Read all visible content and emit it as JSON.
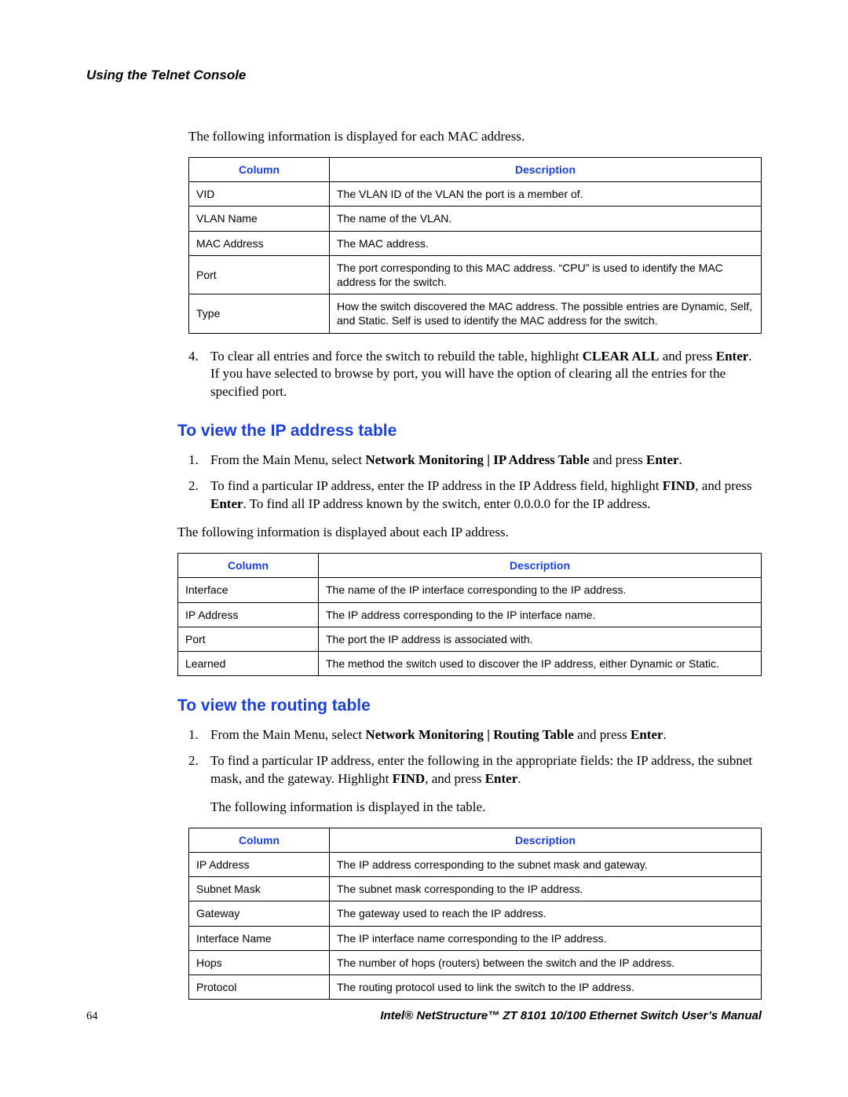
{
  "header": {
    "running_title": "Using the Telnet Console"
  },
  "intro1": "The following information is displayed for each MAC address.",
  "table1": {
    "head_col": "Column",
    "head_desc": "Description",
    "rows": [
      {
        "c": "VID",
        "d": "The VLAN ID of the VLAN the port is a member of."
      },
      {
        "c": "VLAN Name",
        "d": "The name of the VLAN."
      },
      {
        "c": "MAC Address",
        "d": "The MAC address."
      },
      {
        "c": "Port",
        "d": "The port corresponding to this MAC address. “CPU” is used to identify the MAC address for the switch."
      },
      {
        "c": "Type",
        "d": "How the switch discovered the MAC address. The possible entries are Dynamic, Self, and Static. Self is used to identify the MAC address for the switch."
      }
    ]
  },
  "step_a": {
    "num": "4.",
    "t1": "To clear all entries and force the switch to rebuild the table, highlight ",
    "b1": "CLEAR ALL",
    "t2": " and press ",
    "b2": "Enter",
    "t3": ". If you have selected to browse by port, you will have the option of clearing all the entries for the specified port."
  },
  "section2": {
    "title": "To view the IP address table"
  },
  "step_b1": {
    "num": "1.",
    "t1": "From the Main Menu, select ",
    "b1": "Network Monitoring | IP Address Table",
    "t2": " and press ",
    "b2": "Enter",
    "t3": "."
  },
  "step_b2": {
    "num": "2.",
    "t1": "To find a particular IP address, enter the IP address in the IP Address field, highlight ",
    "b1": "FIND",
    "t2": ", and press ",
    "b2": "Enter",
    "t3": ". To find all IP address known by the switch, enter 0.0.0.0 for the IP address."
  },
  "intro2": "The following information is displayed about each IP address.",
  "table2": {
    "head_col": "Column",
    "head_desc": "Description",
    "rows": [
      {
        "c": "Interface",
        "d": "The name of the IP interface corresponding to the IP address."
      },
      {
        "c": "IP Address",
        "d": "The IP address corresponding to the IP interface name."
      },
      {
        "c": "Port",
        "d": "The port the IP address is associated with."
      },
      {
        "c": "Learned",
        "d": "The method the switch used to discover the IP address, either Dynamic or Static."
      }
    ]
  },
  "section3": {
    "title": "To view the routing table"
  },
  "step_c1": {
    "num": "1.",
    "t1": "From the Main Menu, select ",
    "b1": "Network Monitoring | Routing Table",
    "t2": " and press ",
    "b2": "Enter",
    "t3": "."
  },
  "step_c2": {
    "num": "2.",
    "t1": "To find a particular IP address, enter the following in the appropriate fields: the IP address, the subnet mask, and the gateway. Highlight ",
    "b1": "FIND",
    "t2": ", and press ",
    "b2": "Enter",
    "t3": "."
  },
  "intro3": "The following information is displayed in the table.",
  "table3": {
    "head_col": "Column",
    "head_desc": "Description",
    "rows": [
      {
        "c": "IP Address",
        "d": "The IP address corresponding to the subnet mask and gateway."
      },
      {
        "c": "Subnet Mask",
        "d": "The subnet mask corresponding to the IP address."
      },
      {
        "c": "Gateway",
        "d": "The gateway used to reach the IP address."
      },
      {
        "c": "Interface Name",
        "d": "The IP interface name corresponding to the IP address."
      },
      {
        "c": "Hops",
        "d": "The number of hops (routers) between the switch and the IP address."
      },
      {
        "c": "Protocol",
        "d": "The routing protocol used to link the switch to the IP address."
      }
    ]
  },
  "footer": {
    "page": "64",
    "title": "Intel® NetStructure™  ZT 8101 10/100 Ethernet Switch User’s Manual"
  }
}
